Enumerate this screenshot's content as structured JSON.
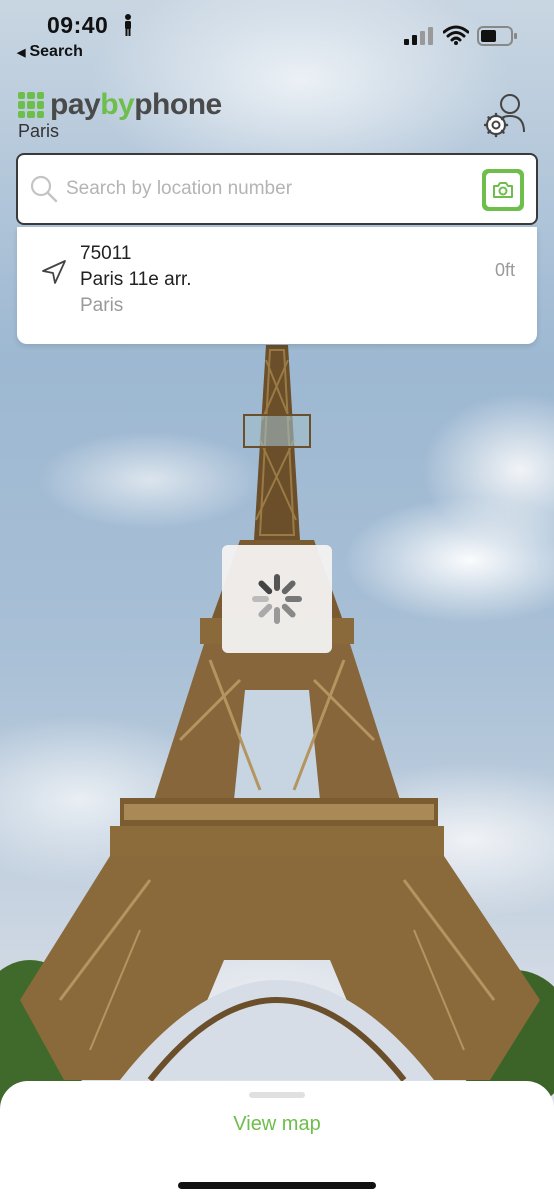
{
  "status_bar": {
    "time": "09:40",
    "back_label": "Search"
  },
  "header": {
    "logo_part1": "pay",
    "logo_part2": "by",
    "logo_part3": "phone",
    "city": "Paris"
  },
  "search": {
    "placeholder": "Search by location number"
  },
  "suggestion": {
    "code": "75011",
    "name": "Paris 11e arr.",
    "city": "Paris",
    "distance": "0ft"
  },
  "bottom_sheet": {
    "view_map_label": "View map"
  },
  "colors": {
    "brand_green": "#6dbe4b",
    "logo_gray": "#4a4a4a"
  }
}
